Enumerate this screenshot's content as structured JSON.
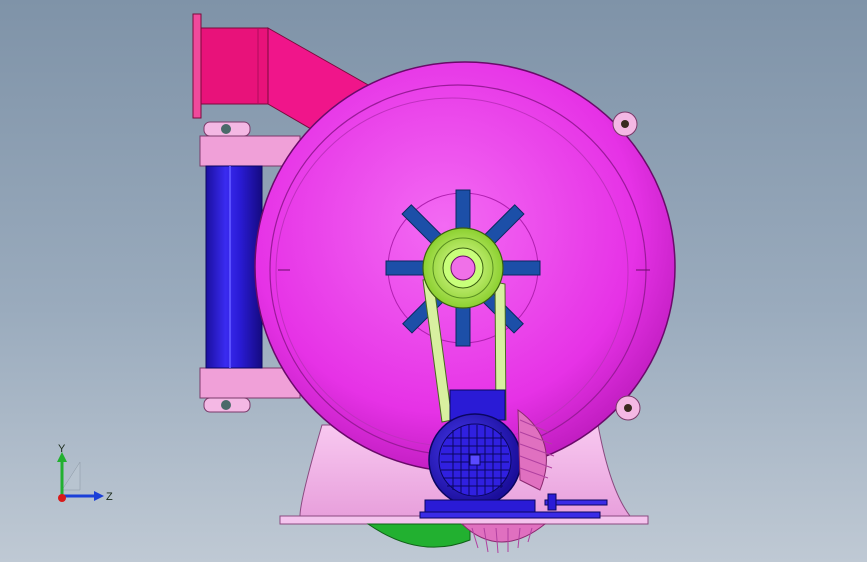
{
  "viewport": {
    "background_top": "#7f93a8",
    "background_bottom": "#bfc9d4"
  },
  "model": {
    "parts": [
      {
        "name": "inlet-duct",
        "color": "#e8127a"
      },
      {
        "name": "fan-housing",
        "color": "#e632e6"
      },
      {
        "name": "roller-drum",
        "color": "#2a1bd6"
      },
      {
        "name": "drum-end-caps",
        "color": "#f0a0d8"
      },
      {
        "name": "pulley",
        "color": "#b8f060"
      },
      {
        "name": "impeller-blades",
        "color": "#1c4fa8"
      },
      {
        "name": "v-belt",
        "color": "#d8f0a0"
      },
      {
        "name": "motor",
        "color": "#2a1bd6"
      },
      {
        "name": "base-frame",
        "color": "#f0b0e8"
      },
      {
        "name": "brush-roller",
        "color": "#e070c0"
      },
      {
        "name": "green-wheel",
        "color": "#22b030"
      }
    ]
  },
  "triad": {
    "y_label": "Y",
    "z_label": "Z",
    "y_color": "#22b030",
    "z_color": "#1a3fd8",
    "x_color": "#d81a1a"
  }
}
